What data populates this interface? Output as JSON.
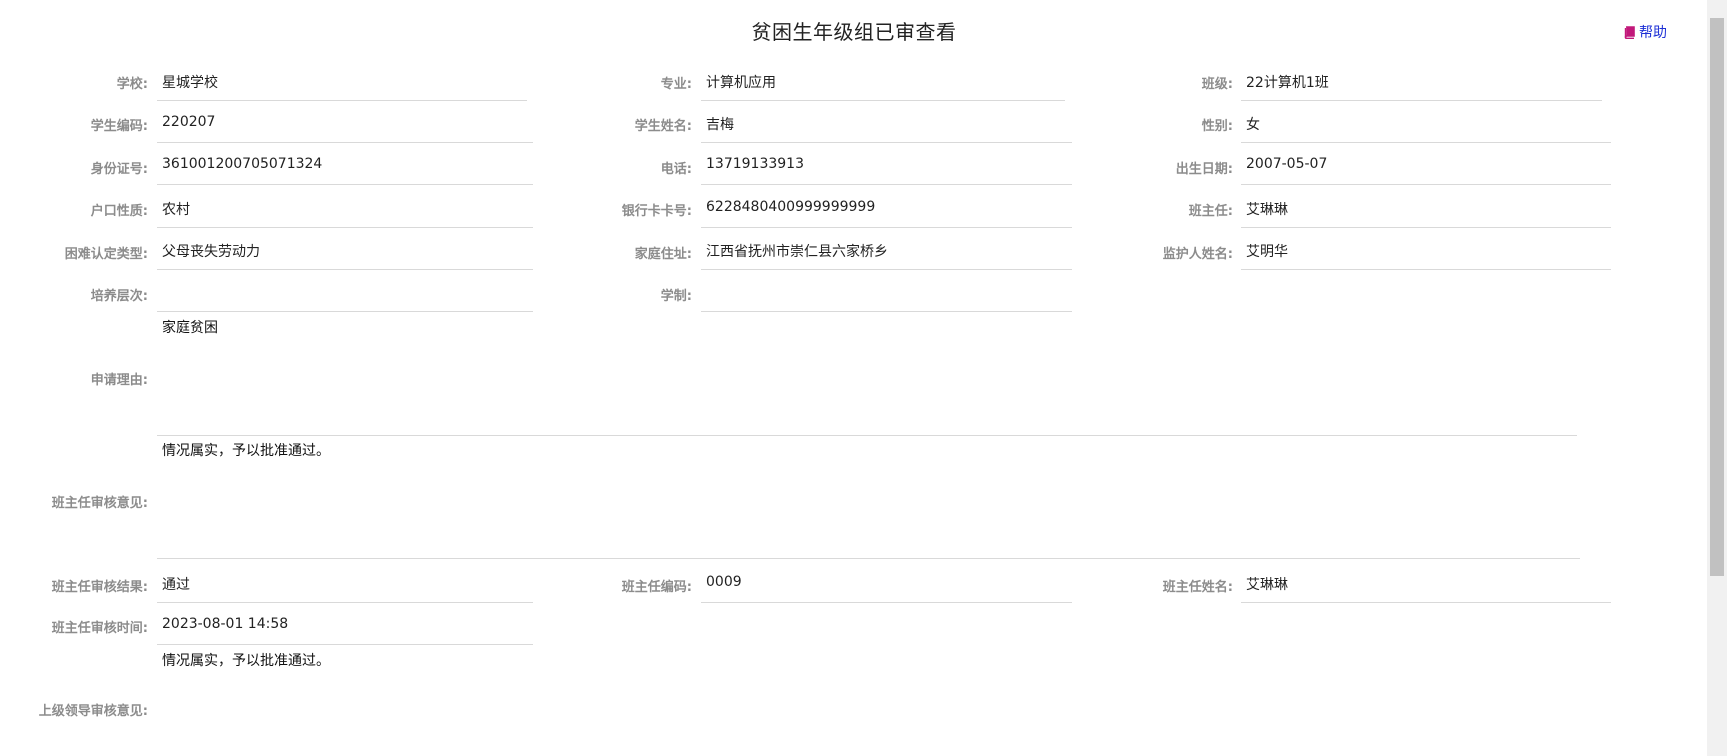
{
  "page": {
    "title": "贫困生年级组已审查看",
    "help": "帮助"
  },
  "rows": {
    "r1": {
      "school": {
        "label": "学校:",
        "value": "星城学校"
      },
      "major": {
        "label": "专业:",
        "value": "计算机应用"
      },
      "class": {
        "label": "班级:",
        "value": "22计算机1班"
      }
    },
    "r2": {
      "student_code": {
        "label": "学生编码:",
        "value": "220207"
      },
      "student_name": {
        "label": "学生姓名:",
        "value": "吉梅"
      },
      "gender": {
        "label": "性别:",
        "value": "女"
      }
    },
    "r3": {
      "id_number": {
        "label": "身份证号:",
        "value": "361001200705071324"
      },
      "phone": {
        "label": "电话:",
        "value": "13719133913"
      },
      "birth_date": {
        "label": "出生日期:",
        "value": "2007-05-07"
      }
    },
    "r4": {
      "household_type": {
        "label": "户口性质:",
        "value": "农村"
      },
      "bank_card": {
        "label": "银行卡卡号:",
        "value": "6228480400999999999"
      },
      "head_teacher": {
        "label": "班主任:",
        "value": "艾琳琳"
      }
    },
    "r5": {
      "difficulty_type": {
        "label": "困难认定类型:",
        "value": "父母丧失劳动力"
      },
      "home_address": {
        "label": "家庭住址:",
        "value": "江西省抚州市崇仁县六家桥乡"
      },
      "guardian_name": {
        "label": "监护人姓名:",
        "value": "艾明华"
      }
    },
    "r6": {
      "training_level": {
        "label": "培养层次:",
        "value": ""
      },
      "school_system": {
        "label": "学制:",
        "value": ""
      }
    }
  },
  "reasons": {
    "application_reason": {
      "label": "申请理由:",
      "value": "家庭贫困"
    },
    "head_teacher_opinion": {
      "label": "班主任审核意见:",
      "value": "情况属实，予以批准通过。"
    }
  },
  "review": {
    "result": {
      "label": "班主任审核结果:",
      "value": "通过"
    },
    "reviewer_code": {
      "label": "班主任编码:",
      "value": "0009"
    },
    "reviewer_name": {
      "label": "班主任姓名:",
      "value": "艾琳琳"
    },
    "review_time": {
      "label": "班主任审核时间:",
      "value": "2023-08-01 14:58"
    }
  },
  "leader": {
    "opinion": {
      "label": "上级领导审核意见:",
      "value": "情况属实，予以批准通过。"
    }
  },
  "colors": {
    "label": "#8c8c8c",
    "text": "#222222",
    "link": "#1c2fd6",
    "help_icon": "#c2187a",
    "divider": "#d9d9d9"
  },
  "icons": {
    "help": "book-icon"
  }
}
